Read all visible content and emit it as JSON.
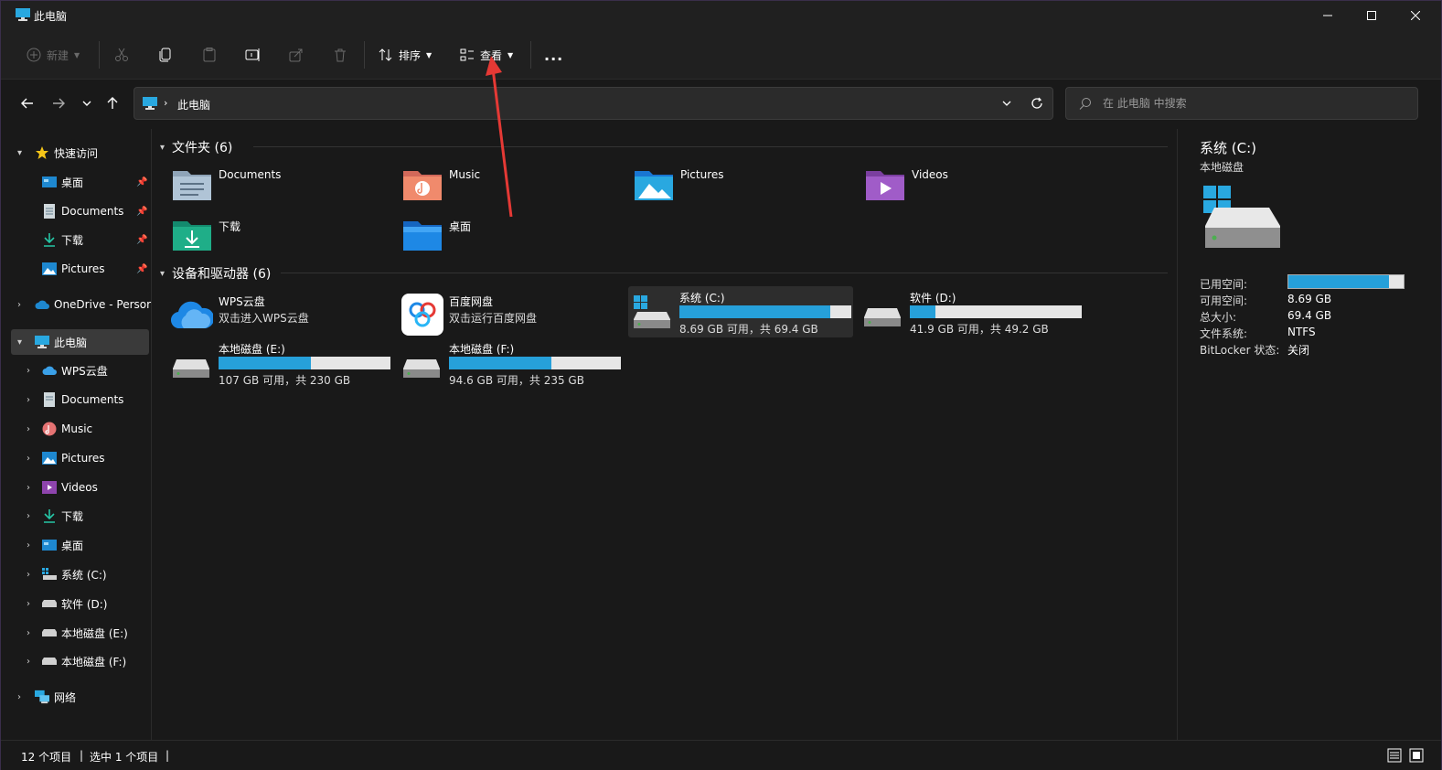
{
  "window": {
    "title": "此电脑"
  },
  "toolbar": {
    "new_label": "新建",
    "sort_label": "排序",
    "view_label": "查看",
    "more_label": "..."
  },
  "address": {
    "crumb": "此电脑"
  },
  "search": {
    "placeholder": "在 此电脑 中搜索"
  },
  "sidebar": {
    "quick_access": "快速访问",
    "quick_items": [
      {
        "label": "桌面"
      },
      {
        "label": "Documents"
      },
      {
        "label": "下载"
      },
      {
        "label": "Pictures"
      }
    ],
    "onedrive": "OneDrive - Persor",
    "this_pc": "此电脑",
    "pc_items": [
      {
        "label": "WPS云盘"
      },
      {
        "label": "Documents"
      },
      {
        "label": "Music"
      },
      {
        "label": "Pictures"
      },
      {
        "label": "Videos"
      },
      {
        "label": "下载"
      },
      {
        "label": "桌面"
      },
      {
        "label": "系统 (C:)"
      },
      {
        "label": "软件 (D:)"
      },
      {
        "label": "本地磁盘 (E:)"
      },
      {
        "label": "本地磁盘 (F:)"
      }
    ],
    "network": "网络"
  },
  "main": {
    "folders_header": "文件夹 (6)",
    "folders": [
      {
        "name": "Documents",
        "icon": "documents-folder-icon"
      },
      {
        "name": "Music",
        "icon": "music-folder-icon"
      },
      {
        "name": "Pictures",
        "icon": "pictures-folder-icon"
      },
      {
        "name": "Videos",
        "icon": "videos-folder-icon"
      },
      {
        "name": "下载",
        "icon": "downloads-folder-icon"
      },
      {
        "name": "桌面",
        "icon": "desktop-folder-icon"
      }
    ],
    "devices_header": "设备和驱动器 (6)",
    "clouds": [
      {
        "name": "WPS云盘",
        "desc": "双击进入WPS云盘"
      },
      {
        "name": "百度网盘",
        "desc": "双击运行百度网盘"
      }
    ],
    "drives": [
      {
        "name": "系统 (C:)",
        "size": "8.69 GB 可用，共 69.4 GB",
        "used_fraction": 0.875
      },
      {
        "name": "软件 (D:)",
        "size": "41.9 GB 可用，共 49.2 GB",
        "used_fraction": 0.148
      },
      {
        "name": "本地磁盘 (E:)",
        "size": "107 GB 可用，共 230 GB",
        "used_fraction": 0.535
      },
      {
        "name": "本地磁盘 (F:)",
        "size": "94.6 GB 可用，共 235 GB",
        "used_fraction": 0.597
      }
    ]
  },
  "details": {
    "title": "系统 (C:)",
    "subtitle": "本地磁盘",
    "used_label": "已用空间:",
    "used_fraction": 0.875,
    "free_label": "可用空间:",
    "free_value": "8.69 GB",
    "total_label": "总大小:",
    "total_value": "69.4 GB",
    "fs_label": "文件系统:",
    "fs_value": "NTFS",
    "bitlocker_label": "BitLocker 状态:",
    "bitlocker_value": "关闭"
  },
  "status": {
    "items": "12 个项目",
    "selected": "选中 1 个项目"
  },
  "colors": {
    "accent": "#26a0da",
    "background": "#191919",
    "annotation": "#e53935"
  }
}
